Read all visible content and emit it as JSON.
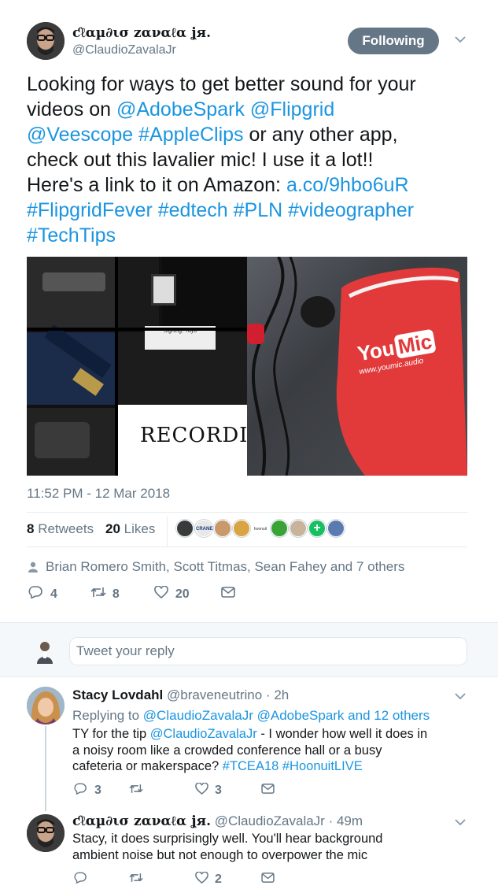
{
  "tweet": {
    "author_name": "ƈℓαµ∂ισ zαναℓα ʝя.",
    "author_handle": "@ClaudioZavalaJr",
    "follow_label": "Following",
    "text_lines": [
      {
        "pre": "Looking for ways to get better sound for your",
        "link": ""
      },
      {
        "pre": "videos on ",
        "link": "@AdobeSpark @Flipgrid"
      },
      {
        "pre": "",
        "link": "@Veescope #AppleClips",
        "post": " or any other app,"
      },
      {
        "pre": "check out this lavalier mic! I use it a lot!!",
        "link": ""
      },
      {
        "pre": "Here's a link to it on Amazon: ",
        "link": "a.co/9hbo6uR"
      },
      {
        "pre": "",
        "link": "#FlipgridFever #edtech #PLN #videographer"
      },
      {
        "pre": "",
        "link": "#TechTips"
      }
    ],
    "media_left_caption": "RECORDING TI",
    "media_left_small": "Signing: Yayo",
    "media_right_logo_a": "You",
    "media_right_logo_b": "Mic",
    "media_right_url": "www.youmic.audio",
    "timestamp": "11:52 PM - 12 Mar 2018",
    "retweets_count": "8",
    "retweets_label": "Retweets",
    "likes_count": "20",
    "likes_label": "Likes",
    "liked_by": "Brian Romero Smith, Scott Titmas, Sean Fahey and 7 others",
    "actions": {
      "replies": "4",
      "retweets": "8",
      "likes": "20"
    },
    "liker_avatars": [
      "#3a3a3a",
      "#e8e8e8",
      "#c9986b",
      "#d9a441",
      "#ffffff",
      "#3aa335",
      "#c8b49a",
      "#17bf63",
      "#5b7bb0"
    ],
    "crane_text": "CRANE",
    "hoonuit_text": "hoonuit"
  },
  "reply_box": {
    "placeholder": "Tweet your reply"
  },
  "replies": [
    {
      "name": "Stacy Lovdahl",
      "handle": "@braveneutrino",
      "time": "· 2h",
      "replying_to_prefix": "Replying to",
      "replying_to": "@ClaudioZavalaJr @AdobeSpark",
      "replying_and": "and 12 others",
      "lines": [
        {
          "pre": "TY for the tip ",
          "link": "@ClaudioZavalaJr",
          "post": " - I wonder how well it does in"
        },
        {
          "pre": "a noisy room like a crowded conference hall or a busy",
          "link": "",
          "post": ""
        },
        {
          "pre": "cafeteria or makerspace? ",
          "link": "#TCEA18 #HoonuitLIVE",
          "post": ""
        }
      ],
      "replies_count": "3",
      "retweets_count": "",
      "likes_count": "3"
    },
    {
      "name": "ƈℓαµ∂ισ zαναℓα ʝя.",
      "handle": "@ClaudioZavalaJr",
      "time": "· 49m",
      "lines": [
        {
          "pre": "Stacy, it does surprisingly well. You'll hear background",
          "link": "",
          "post": ""
        },
        {
          "pre": "ambient noise but not enough to overpower the mic",
          "link": "",
          "post": ""
        }
      ],
      "replies_count": "",
      "retweets_count": "",
      "likes_count": "2"
    }
  ]
}
